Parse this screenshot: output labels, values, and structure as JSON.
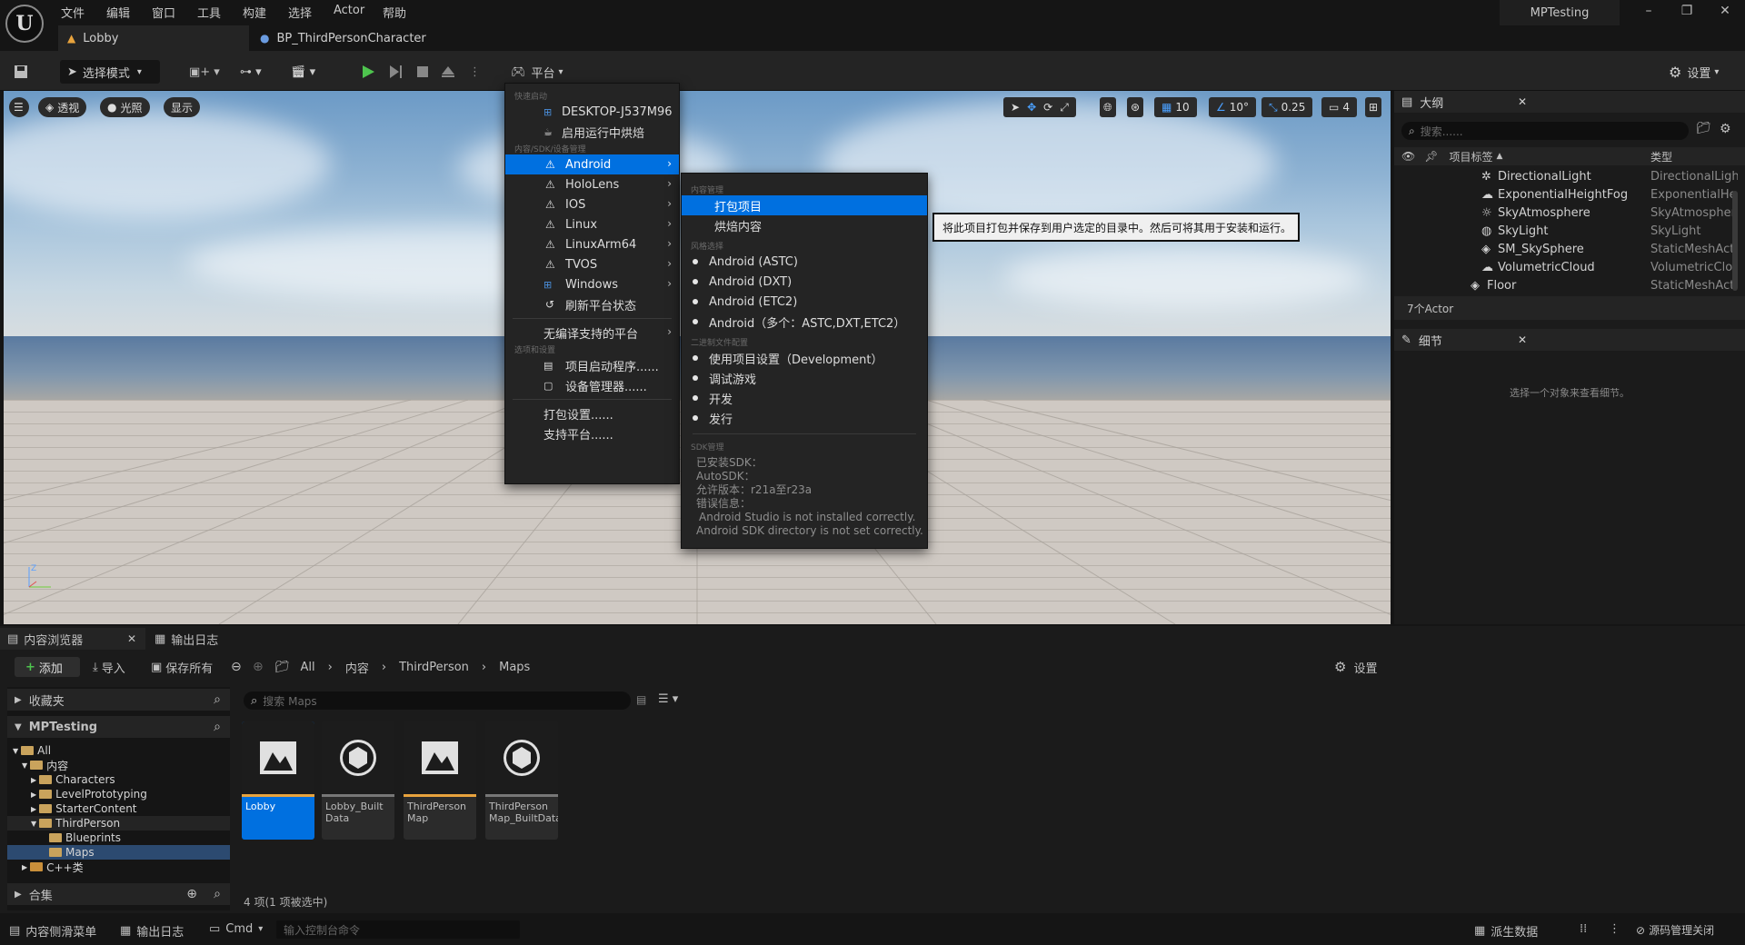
{
  "menubar": {
    "items": [
      "文件",
      "编辑",
      "窗口",
      "工具",
      "构建",
      "选择",
      "Actor",
      "帮助"
    ],
    "project": "MPTesting"
  },
  "tabs": [
    {
      "label": "Lobby"
    },
    {
      "label": "BP_ThirdPersonCharacter"
    }
  ],
  "toolbar": {
    "mode": "选择模式",
    "platform": "平台",
    "settings": "设置"
  },
  "viewport": {
    "perspective": "透视",
    "lighting": "光照",
    "show": "显示",
    "grid": "10",
    "angle": "10°",
    "scale": "0.25",
    "camera": "4"
  },
  "platform_menu": {
    "sec_quick": "快速启动",
    "device": "DESKTOP-J537M96",
    "cook_on_fly": "启用运行中烘焙",
    "sec_sdk": "内容/SDK/设备管理",
    "platforms": [
      "Android",
      "HoloLens",
      "IOS",
      "Linux",
      "LinuxArm64",
      "TVOS",
      "Windows"
    ],
    "refresh": "刷新平台状态",
    "no_compile": "无编译支持的平台",
    "sec_options": "选项和设置",
    "launcher": "项目启动程序......",
    "device_manager": "设备管理器......",
    "package_settings": "打包设置......",
    "supported_platforms": "支持平台......"
  },
  "android_menu": {
    "sec_content": "内容管理",
    "package": "打包项目",
    "cook": "烘焙内容",
    "sec_format": "风格选择",
    "formats": [
      "Android (ASTC)",
      "Android (DXT)",
      "Android (ETC2)",
      "Android（多个：ASTC,DXT,ETC2）"
    ],
    "sec_binary": "二进制文件配置",
    "configs": [
      "使用项目设置（Development）",
      "调试游戏",
      "开发",
      "发行"
    ],
    "sec_sdkmgmt": "SDK管理",
    "sdk_lines": [
      "已安装SDK：",
      "AutoSDK：",
      "允许版本：r21a至r23a",
      "错误信息：",
      "Android Studio is not installed correctly.",
      "Android SDK directory is not set correctly."
    ]
  },
  "tooltip": "将此项目打包并保存到用户选定的目录中。然后可将其用于安装和运行。",
  "outliner": {
    "title": "大纲",
    "search_placeholder": "搜索......",
    "col_label": "项目标签",
    "col_type": "类型",
    "rows": [
      {
        "label": "DirectionalLight",
        "type": "DirectionalLigh"
      },
      {
        "label": "ExponentialHeightFog",
        "type": "ExponentialHe"
      },
      {
        "label": "SkyAtmosphere",
        "type": "SkyAtmospher"
      },
      {
        "label": "SkyLight",
        "type": "SkyLight"
      },
      {
        "label": "SM_SkySphere",
        "type": "StaticMeshAct"
      },
      {
        "label": "VolumetricCloud",
        "type": "VolumetricClou"
      },
      {
        "label": "Floor",
        "type": "StaticMeshAct"
      }
    ],
    "count": "7个Actor"
  },
  "details": {
    "title": "细节",
    "empty": "选择一个对象来查看细节。"
  },
  "content_browser": {
    "title": "内容浏览器",
    "output_log": "输出日志",
    "add": "添加",
    "import": "导入",
    "save_all": "保存所有",
    "breadcrumb": [
      "All",
      "内容",
      "ThirdPerson",
      "Maps"
    ],
    "settings": "设置",
    "favorites": "收藏夹",
    "project": "MPTesting",
    "tree": [
      {
        "label": "All",
        "depth": 0
      },
      {
        "label": "内容",
        "depth": 1
      },
      {
        "label": "Characters",
        "depth": 2
      },
      {
        "label": "LevelPrototyping",
        "depth": 2
      },
      {
        "label": "StarterContent",
        "depth": 2
      },
      {
        "label": "ThirdPerson",
        "depth": 2
      },
      {
        "label": "Blueprints",
        "depth": 3
      },
      {
        "label": "Maps",
        "depth": 3
      },
      {
        "label": "C++类",
        "depth": 1
      }
    ],
    "collections": "合集",
    "search_placeholder": "搜索 Maps",
    "assets": [
      {
        "label": "Lobby"
      },
      {
        "label": "Lobby_Built Data"
      },
      {
        "label": "ThirdPerson Map"
      },
      {
        "label": "ThirdPerson Map_BuiltData"
      }
    ],
    "status": "4 项(1 项被选中)"
  },
  "statusbar": {
    "drawer": "内容侧滑菜单",
    "output": "输出日志",
    "cmd": "Cmd",
    "console_placeholder": "输入控制台命令",
    "derived": "派生数据",
    "source": "源码管理关闭"
  }
}
